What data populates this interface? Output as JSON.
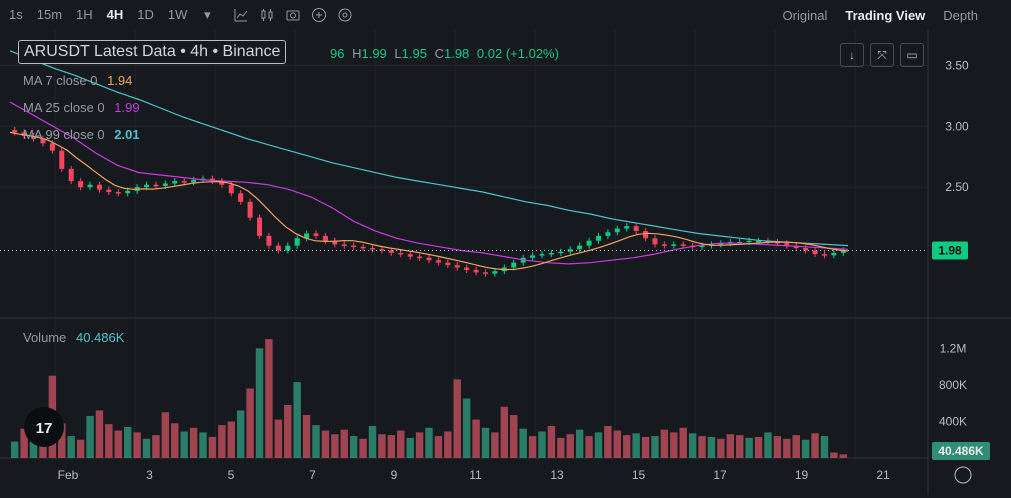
{
  "toolbar": {
    "timeframes": [
      "1s",
      "15m",
      "1H",
      "4H",
      "1D",
      "1W"
    ],
    "active_timeframe": "4H",
    "icons": [
      "chevron-down-icon",
      "indicator-icon",
      "candle-type-icon",
      "camera-icon",
      "add-icon",
      "settings-icon"
    ]
  },
  "views": {
    "original": "Original",
    "trading_view": "Trading View",
    "depth": "Depth"
  },
  "legend": {
    "symbol": "ARUSDT Latest Data • 4h • Binance",
    "open_partial": "96",
    "high_k": "H",
    "high": "1.99",
    "low_k": "L",
    "low": "1.95",
    "close_k": "C",
    "close": "1.98",
    "change": "0.02 (+1.02%)",
    "ma7_label": "MA 7 close 0",
    "ma7_value": "1.94",
    "ma7_color": "#f0a35e",
    "ma25_label": "MA 25 close 0",
    "ma25_value": "1.99",
    "ma25_color": "#c93be0",
    "ma99_label": "MA 99 close 0",
    "ma99_value": "2.01",
    "ma99_color": "#4ec3c8"
  },
  "volume": {
    "label": "Volume",
    "value": "40.486K"
  },
  "colors": {
    "up": "#2e8f74",
    "down": "#b94c5a",
    "bg": "#161a1e",
    "grid": "#23272d"
  },
  "chart_data": {
    "type": "candlestick",
    "price_axis": {
      "ticks": [
        3.5,
        3.0,
        2.5
      ],
      "tick_labels": [
        "3.50",
        "3.00",
        "2.50"
      ],
      "ylim": [
        1.45,
        3.75
      ],
      "current": 1.98,
      "current_label": "1.98"
    },
    "volume_axis": {
      "ticks": [
        1200000,
        800000,
        400000
      ],
      "tick_labels": [
        "1.2M",
        "800K",
        "400K"
      ],
      "current_label": "40.486K"
    },
    "x_tick_labels": [
      "Feb",
      "3",
      "5",
      "7",
      "9",
      "11",
      "13",
      "15",
      "17",
      "19",
      "21"
    ],
    "close_series": [
      2.95,
      2.92,
      2.9,
      2.86,
      2.8,
      2.65,
      2.55,
      2.5,
      2.52,
      2.48,
      2.46,
      2.45,
      2.47,
      2.5,
      2.52,
      2.51,
      2.53,
      2.55,
      2.54,
      2.56,
      2.57,
      2.55,
      2.52,
      2.45,
      2.38,
      2.25,
      2.1,
      2.02,
      1.98,
      2.02,
      2.08,
      2.12,
      2.1,
      2.06,
      2.03,
      2.02,
      2.01,
      2.0,
      1.99,
      1.98,
      1.96,
      1.95,
      1.93,
      1.92,
      1.9,
      1.88,
      1.86,
      1.84,
      1.82,
      1.8,
      1.79,
      1.81,
      1.84,
      1.88,
      1.92,
      1.94,
      1.95,
      1.96,
      1.97,
      1.99,
      2.02,
      2.06,
      2.1,
      2.13,
      2.16,
      2.18,
      2.14,
      2.08,
      2.03,
      2.02,
      2.03,
      2.02,
      2.01,
      2.02,
      2.03,
      2.04,
      2.05,
      2.05,
      2.06,
      2.06,
      2.05,
      2.04,
      2.02,
      2.0,
      1.98,
      1.95,
      1.94,
      1.96,
      1.98
    ],
    "ma99_series": [
      3.62,
      3.55,
      3.48,
      3.42,
      3.35,
      3.28,
      3.22,
      3.15,
      3.08,
      3.02,
      2.96,
      2.9,
      2.85,
      2.8,
      2.75,
      2.7,
      2.66,
      2.62,
      2.58,
      2.55,
      2.52,
      2.49,
      2.46,
      2.42,
      2.38,
      2.35,
      2.31,
      2.28,
      2.24,
      2.21,
      2.18,
      2.15,
      2.12,
      2.1,
      2.08,
      2.06,
      2.05,
      2.04,
      2.03,
      2.02
    ],
    "ma25_series": [
      3.2,
      3.1,
      3.0,
      2.9,
      2.78,
      2.68,
      2.62,
      2.6,
      2.58,
      2.56,
      2.55,
      2.54,
      2.52,
      2.48,
      2.42,
      2.33,
      2.22,
      2.14,
      2.08,
      2.04,
      2.01,
      1.98,
      1.96,
      1.93,
      1.9,
      1.88,
      1.87,
      1.88,
      1.9,
      1.92,
      1.95,
      1.99,
      2.02,
      2.04,
      2.04,
      2.03,
      2.02,
      2.01,
      2.0,
      1.99
    ],
    "volume_series": [
      180000,
      320000,
      260000,
      420000,
      900000,
      380000,
      240000,
      200000,
      460000,
      520000,
      370000,
      300000,
      340000,
      280000,
      210000,
      250000,
      500000,
      380000,
      290000,
      330000,
      280000,
      230000,
      360000,
      400000,
      520000,
      760000,
      1200000,
      1300000,
      420000,
      580000,
      830000,
      470000,
      360000,
      300000,
      260000,
      310000,
      240000,
      210000,
      350000,
      260000,
      250000,
      300000,
      220000,
      280000,
      330000,
      240000,
      290000,
      860000,
      650000,
      420000,
      330000,
      280000,
      560000,
      470000,
      320000,
      240000,
      290000,
      350000,
      220000,
      260000,
      310000,
      240000,
      280000,
      350000,
      300000,
      250000,
      270000,
      230000,
      240000,
      310000,
      280000,
      330000,
      270000,
      240000,
      230000,
      210000,
      260000,
      250000,
      220000,
      230000,
      280000,
      240000,
      210000,
      250000,
      200000,
      270000,
      240000,
      60000,
      40000
    ]
  }
}
